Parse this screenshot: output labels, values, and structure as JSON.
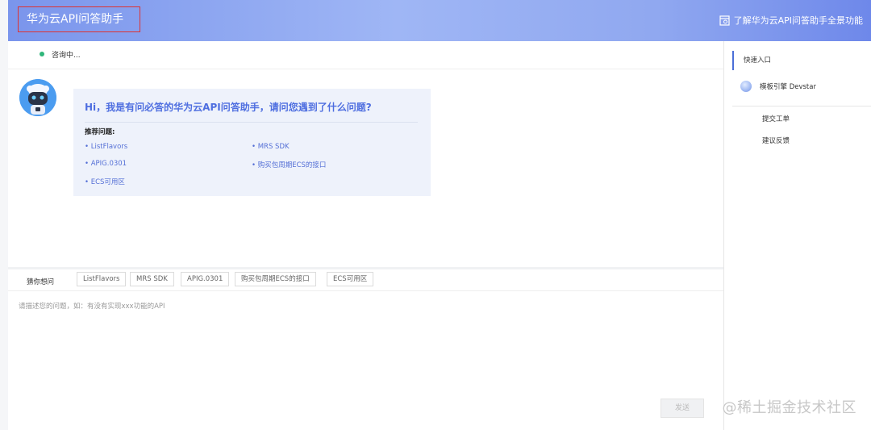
{
  "header": {
    "title": "华为云API问答助手",
    "overview_link": "了解华为云API问答助手全景功能"
  },
  "status": {
    "text": "咨询中..."
  },
  "chat": {
    "greeting": "Hi，我是有问必答的华为云API问答助手，请问您遇到了什么问题?",
    "recommend_label": "推荐问题:",
    "recommend": [
      "ListFlavors",
      "MRS SDK",
      "APIG.0301",
      "购买包周期ECS的接口",
      "ECS可用区"
    ]
  },
  "suggest": {
    "label": "猜你想问",
    "chips": [
      "ListFlavors",
      "MRS SDK",
      "APIG.0301",
      "购买包周期ECS的接口",
      "ECS可用区"
    ]
  },
  "input": {
    "placeholder": "请描述您的问题，如：有没有实现xxx功能的API",
    "value": ""
  },
  "send_label": "发送",
  "sidebar": {
    "quick_entry": "快速入口",
    "devstar": "模板引擎 Devstar",
    "ticket": "提交工单",
    "feedback": "建议反馈"
  },
  "watermark": "@稀土掘金技术社区",
  "colors": {
    "accent": "#4e6ee0",
    "status": "#2fb67a",
    "header_start": "#7a95ec",
    "header_end": "#6e88ea"
  },
  "icons": {
    "overview": "external-panel-icon",
    "bot": "robot-avatar-icon",
    "devstar": "devstar-orb-icon",
    "status": "online-dot-icon"
  }
}
